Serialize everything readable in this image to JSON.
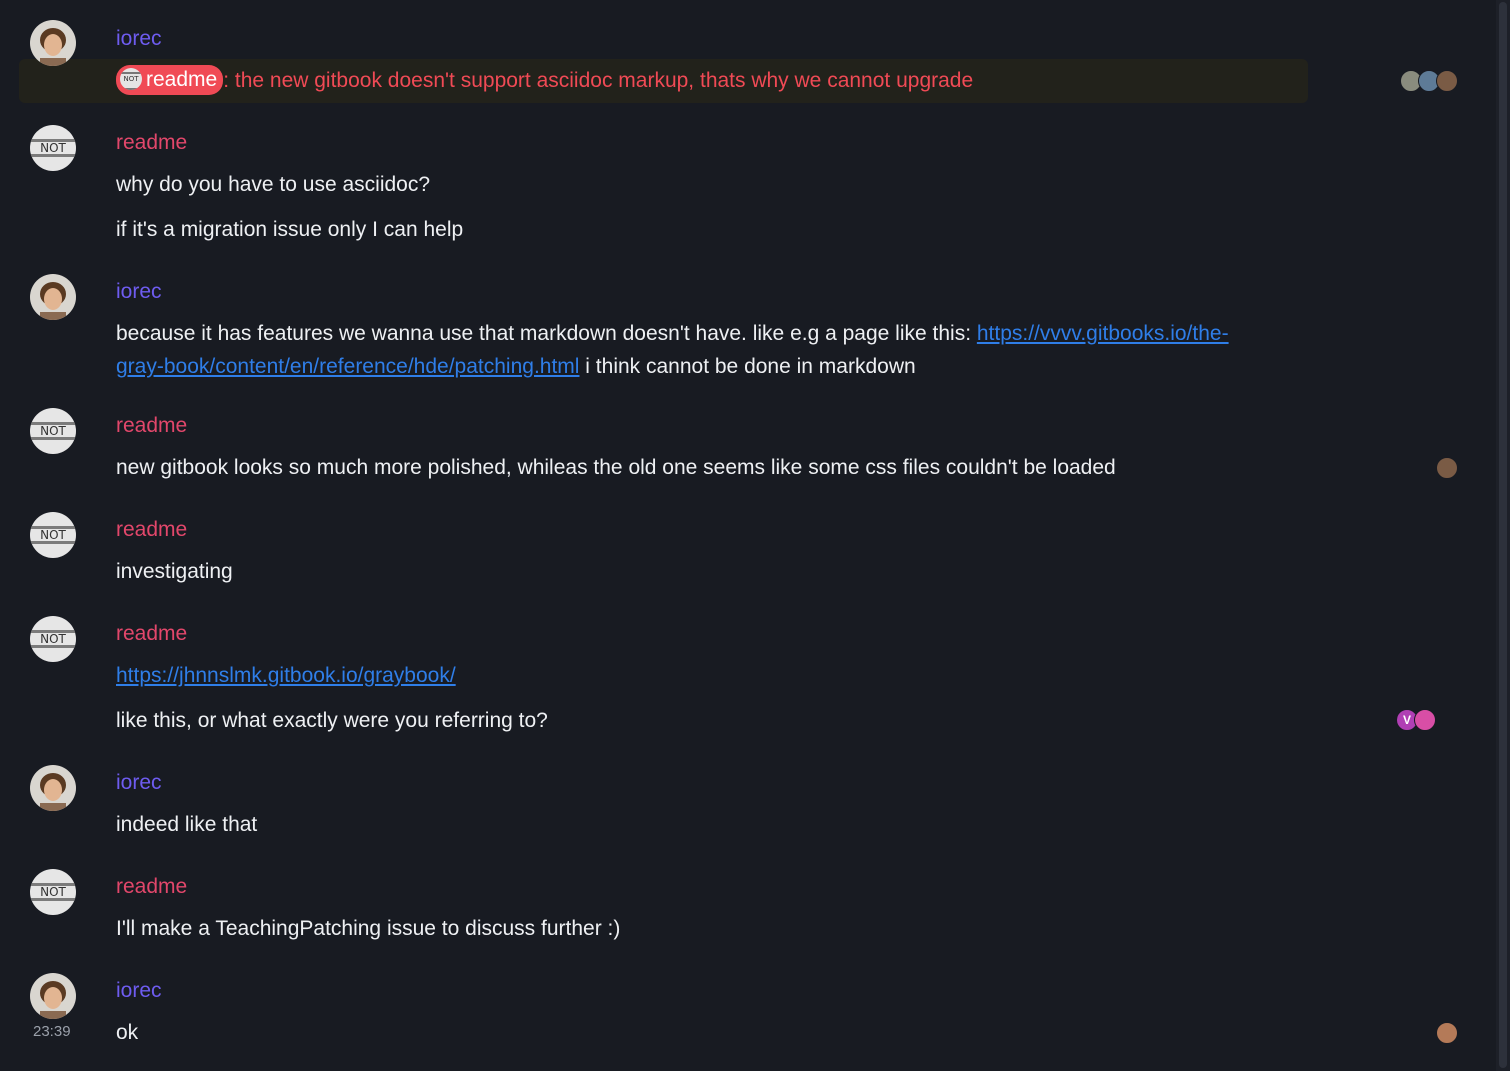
{
  "users": {
    "iorec": "iorec",
    "readme": "readme"
  },
  "avatar_text": "NOT",
  "colors": {
    "background": "#181b22",
    "iorec_name": "#6e5cf0",
    "readme_name": "#e2476b",
    "mention_highlight": "#f04a55",
    "link": "#2f7ee8"
  },
  "messages": [
    {
      "sender": "iorec",
      "lines": [
        {
          "mention": "readme",
          "text": ": the new gitbook doesn't support asciidoc markup, thats why we cannot upgrade"
        }
      ],
      "receipts": [
        "user-avatar-1",
        "user-avatar-2",
        "user-avatar-3"
      ]
    },
    {
      "sender": "readme",
      "lines": [
        "why do you have to use asciidoc?",
        "if it's a migration issue only I can help"
      ]
    },
    {
      "sender": "iorec",
      "lines": [
        {
          "before": "because it has features we wanna use that markdown doesn't have. like e.g a page like this: ",
          "link": "https://vvvv.gitbooks.io/the-gray-book/content/en/reference/hde/patching.html",
          "after": " i think cannot be done in markdown"
        }
      ]
    },
    {
      "sender": "readme",
      "lines": [
        "new gitbook looks so much more polished, whileas the old one seems like some css files couldn't be loaded"
      ],
      "receipts": [
        "user-avatar-3"
      ]
    },
    {
      "sender": "readme",
      "lines": [
        "investigating"
      ]
    },
    {
      "sender": "readme",
      "lines": [
        {
          "link": "https://jhnnslmk.gitbook.io/graybook/"
        },
        "like this, or what exactly were you referring to?"
      ],
      "receipts": [
        "V",
        "user-avatar-4"
      ]
    },
    {
      "sender": "iorec",
      "lines": [
        "indeed like that"
      ]
    },
    {
      "sender": "readme",
      "lines": [
        "I'll make a TeachingPatching issue to discuss further :)"
      ]
    },
    {
      "sender": "iorec",
      "lines": [
        "ok"
      ],
      "timestamp": "23:39",
      "receipts": [
        "user-avatar-5"
      ]
    }
  ]
}
